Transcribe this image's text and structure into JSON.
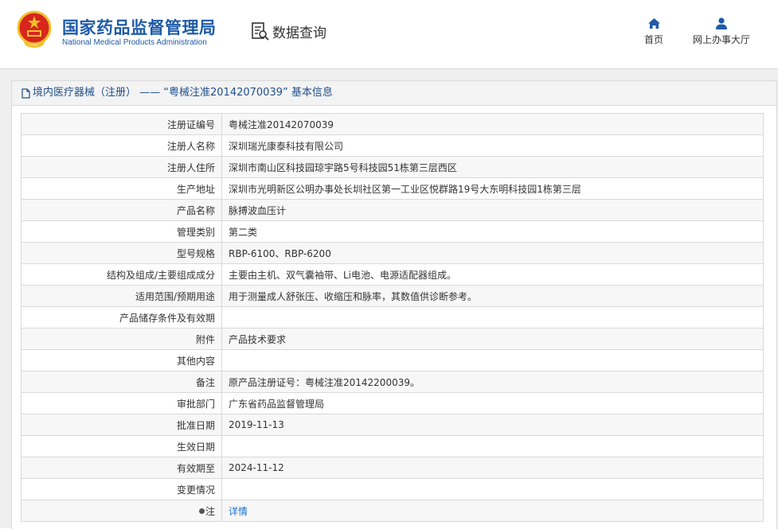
{
  "header": {
    "logo_cn": "国家药品监督管理局",
    "logo_en": "National Medical Products Administration",
    "query_label": "数据查询",
    "nav": {
      "home": "首页",
      "hall": "网上办事大厅"
    }
  },
  "panel": {
    "title": "境内医疗器械（注册） —— “粤械注准20142070039” 基本信息"
  },
  "rows": [
    {
      "label": "注册证编号",
      "value": "粤械注准20142070039"
    },
    {
      "label": "注册人名称",
      "value": "深圳瑞光康泰科技有限公司"
    },
    {
      "label": "注册人住所",
      "value": "深圳市南山区科技园琼宇路5号科技园51栋第三层西区"
    },
    {
      "label": "生产地址",
      "value": "深圳市光明新区公明办事处长圳社区第一工业区悦群路19号大东明科技园1栋第三层"
    },
    {
      "label": "产品名称",
      "value": "脉搏波血压计"
    },
    {
      "label": "管理类别",
      "value": "第二类"
    },
    {
      "label": "型号规格",
      "value": "RBP-6100、RBP-6200"
    },
    {
      "label": "结构及组成/主要组成成分",
      "value": "主要由主机、双气囊袖带、Li电池、电源适配器组成。"
    },
    {
      "label": "适用范围/预期用途",
      "value": "用于测量成人舒张压、收缩压和脉率，其数值供诊断参考。"
    },
    {
      "label": "产品储存条件及有效期",
      "value": ""
    },
    {
      "label": "附件",
      "value": "产品技术要求"
    },
    {
      "label": "其他内容",
      "value": ""
    },
    {
      "label": "备注",
      "value": "原产品注册证号：粤械注准20142200039。"
    },
    {
      "label": "审批部门",
      "value": "广东省药品监督管理局"
    },
    {
      "label": "批准日期",
      "value": "2019-11-13"
    },
    {
      "label": "生效日期",
      "value": ""
    },
    {
      "label": "有效期至",
      "value": "2024-11-12"
    },
    {
      "label": "变更情况",
      "value": ""
    }
  ],
  "note_row": {
    "label": "注",
    "link": "详情"
  },
  "colors": {
    "brand_blue": "#1e5aa8",
    "link_blue": "#1e6fd0",
    "emblem_red": "#d8261c",
    "emblem_gold": "#f2c12e"
  }
}
